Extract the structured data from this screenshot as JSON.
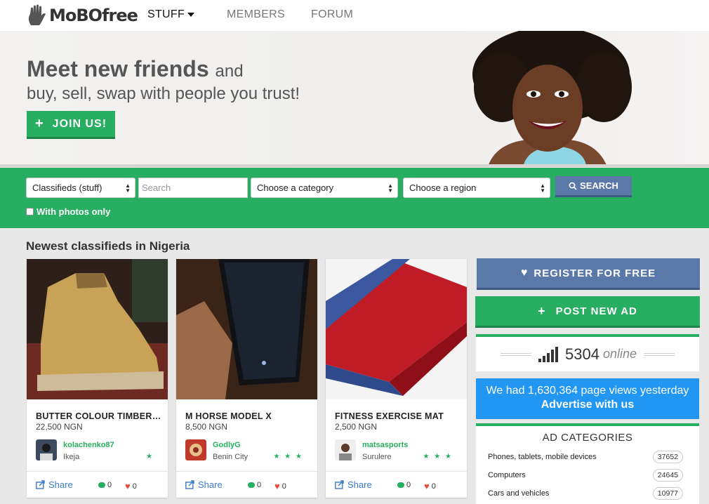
{
  "brand": {
    "logo_text": "MoBOfree"
  },
  "nav": {
    "stuff": "STUFF",
    "members": "MEMBERS",
    "forum": "FORUM"
  },
  "hero": {
    "title": "Meet new friends",
    "title_suffix": "and",
    "subtitle": "buy, sell, swap with people you trust!",
    "join_label": "JOIN US!"
  },
  "search": {
    "type_value": "Classifieds (stuff)",
    "search_placeholder": "Search",
    "category_value": "Choose a category",
    "region_value": "Choose a region",
    "button_label": "SEARCH",
    "photos_only_label": "With photos only"
  },
  "section_title": "Newest classifieds in Nigeria",
  "listings": [
    {
      "title": "BUTTER COLOUR TIMBERLAND",
      "price": "22,500 NGN",
      "user": "kolachenko87",
      "city": "Ikeja",
      "stars": "★",
      "share": "Share",
      "comments": "0",
      "likes": "0"
    },
    {
      "title": "M HORSE MODEL X",
      "price": "8,500 NGN",
      "user": "GodlyG",
      "city": "Benin City",
      "stars": "★ ★ ★",
      "share": "Share",
      "comments": "0",
      "likes": "0"
    },
    {
      "title": "FITNESS EXERCISE MAT",
      "price": "2,500 NGN",
      "user": "matsasports",
      "city": "Surulere",
      "stars": "★ ★ ★",
      "share": "Share",
      "comments": "0",
      "likes": "0"
    }
  ],
  "sidebar": {
    "register_label": "REGISTER FOR FREE",
    "post_label": "POST NEW AD",
    "online_count": "5304",
    "online_label": "online",
    "views_text": "We had 1,630,364 page views yesterday",
    "advertise_text": "Advertise with us",
    "categories_title": "AD CATEGORIES",
    "categories": [
      {
        "name": "Phones, tablets, mobile devices",
        "count": "37652"
      },
      {
        "name": "Computers",
        "count": "24645"
      },
      {
        "name": "Cars and vehicles",
        "count": "10977"
      }
    ]
  },
  "colors": {
    "brand_green": "#27ae60",
    "accent_blue": "#5b79a8",
    "info_blue": "#2196f3",
    "like_red": "#e74c3c"
  }
}
